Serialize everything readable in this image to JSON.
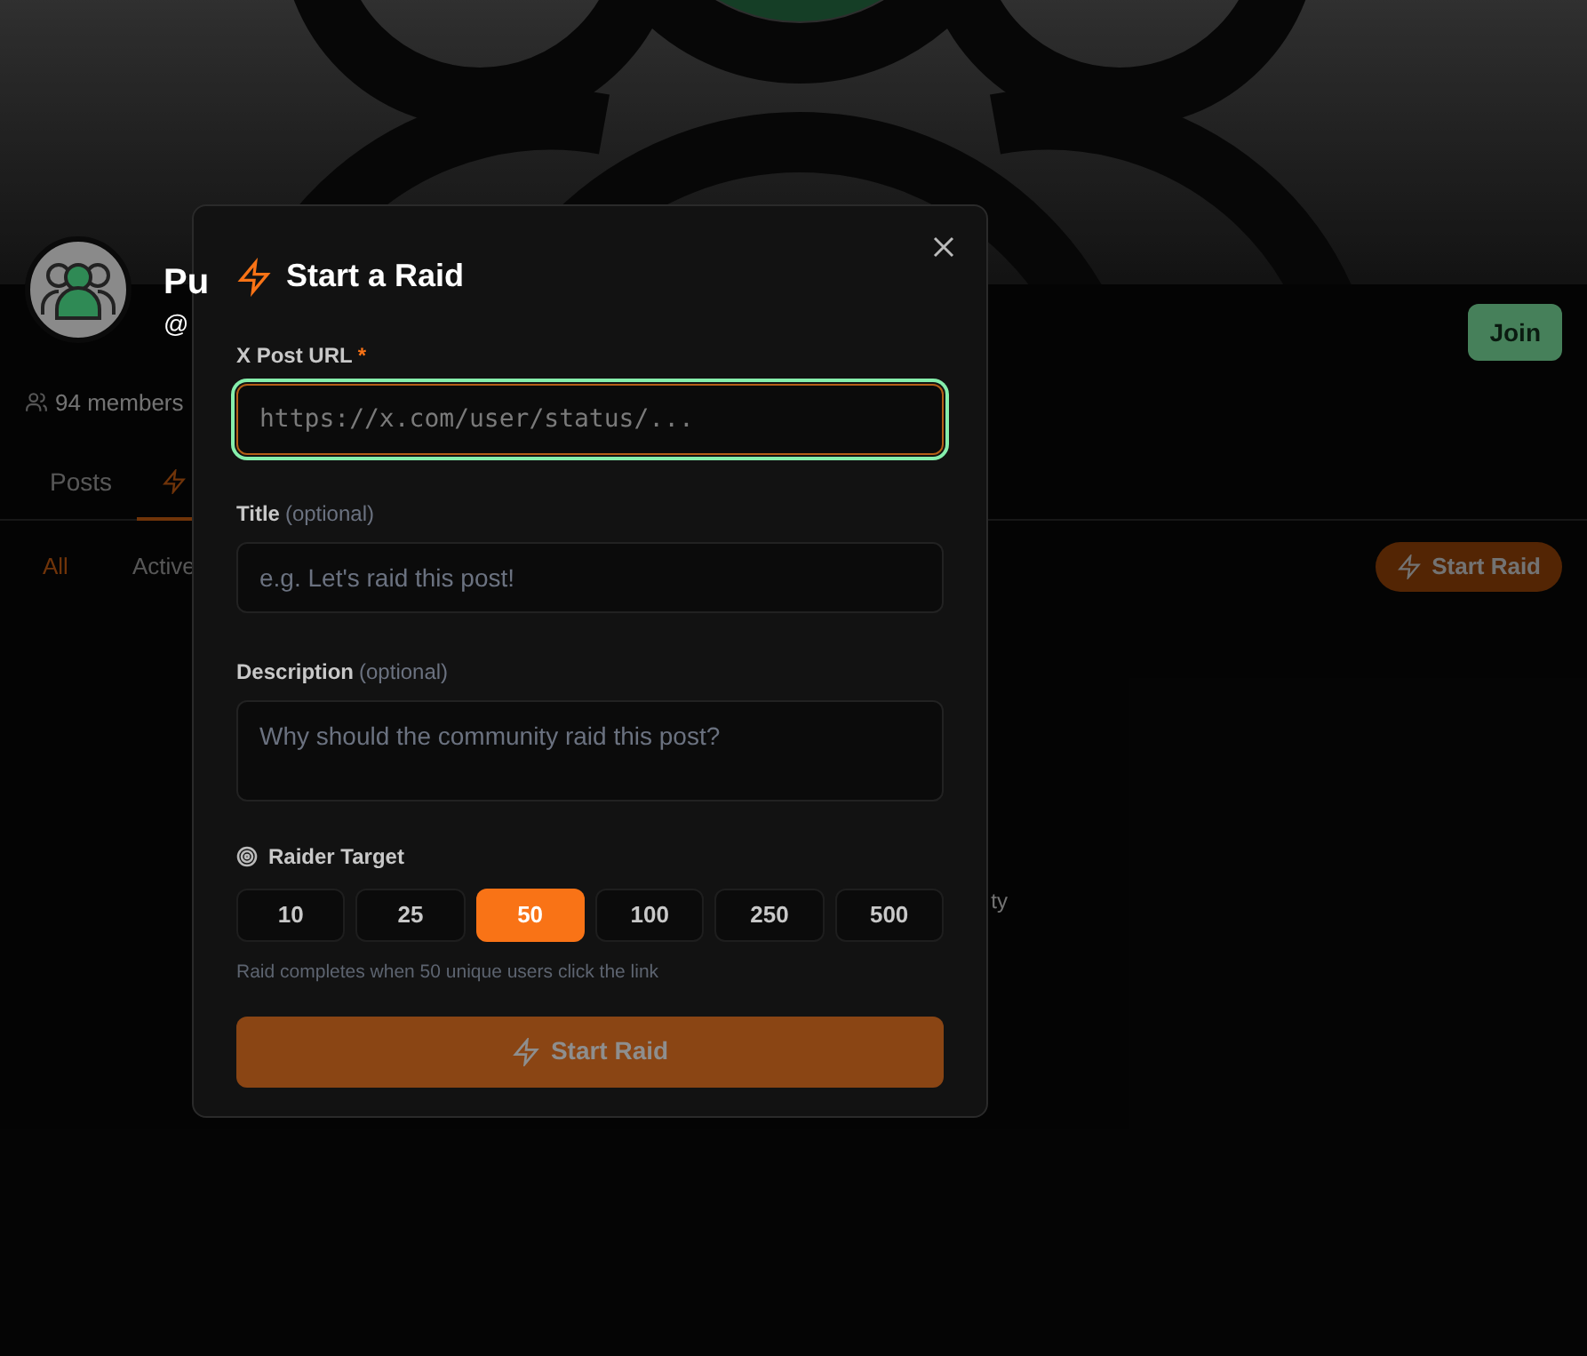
{
  "community": {
    "name": "Pu",
    "handle": "@",
    "members": "94 members",
    "join_button": "Join"
  },
  "tabs": [
    {
      "label": "Posts",
      "selected": false
    },
    {
      "kind": "raids",
      "selected": true
    }
  ],
  "filters": [
    {
      "label": "All",
      "selected": true
    },
    {
      "label": "Active",
      "selected": false
    }
  ],
  "start_raid_button": "Start Raid",
  "empty_text": "ty",
  "modal": {
    "title": "Start a Raid",
    "fields": [
      {
        "kind": "url",
        "label": "X Post URL",
        "required_mark": "*",
        "placeholder": "https://x.com/user/status/...",
        "focused": true
      },
      {
        "kind": "text",
        "label": "Title",
        "hint": "(optional)",
        "placeholder": "e.g. Let's raid this post!",
        "focused": false
      },
      {
        "kind": "textarea",
        "label": "Description",
        "hint": "(optional)",
        "placeholder": "Why should the community raid this post?",
        "focused": false
      }
    ],
    "raider_target": {
      "label": "Raider Target",
      "options": [
        {
          "label": "10",
          "selected": false
        },
        {
          "label": "25",
          "selected": false
        },
        {
          "label": "50",
          "selected": true
        },
        {
          "label": "100",
          "selected": false
        },
        {
          "label": "250",
          "selected": false
        },
        {
          "label": "500",
          "selected": false
        }
      ],
      "helper": "Raid completes when 50 unique users click the link"
    },
    "submit": {
      "label": "Start Raid",
      "disabled": true
    }
  }
}
